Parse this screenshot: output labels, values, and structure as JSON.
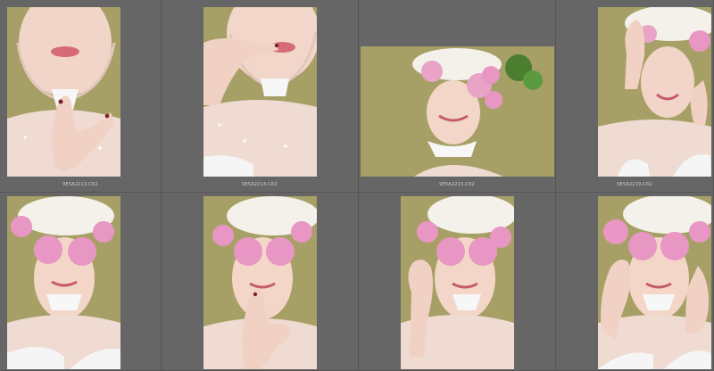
{
  "thumbnails": [
    {
      "filename": "9E5A2213.CR2",
      "icon": "portrait-lips-hand-photo"
    },
    {
      "filename": "9E5A2214.CR2",
      "icon": "portrait-finger-lips-photo"
    },
    {
      "filename": "9E5A2215.CR2",
      "icon": "portrait-flower-hat-photo"
    },
    {
      "filename": "9E5A2219.CR2",
      "icon": "portrait-smile-hands-photo"
    },
    {
      "filename": "",
      "icon": "portrait-flower-glasses-photo"
    },
    {
      "filename": "",
      "icon": "portrait-flower-glasses-finger-photo"
    },
    {
      "filename": "",
      "icon": "portrait-flower-glasses-hand-photo"
    },
    {
      "filename": "",
      "icon": "portrait-flower-glasses-hands-photo"
    }
  ],
  "colors": {
    "panel_background": "#666666",
    "photo_backdrop": "#a7a066",
    "skin": "#f3d8cc",
    "dress": "#efdbd2",
    "flower_pink": "#e896c3"
  }
}
